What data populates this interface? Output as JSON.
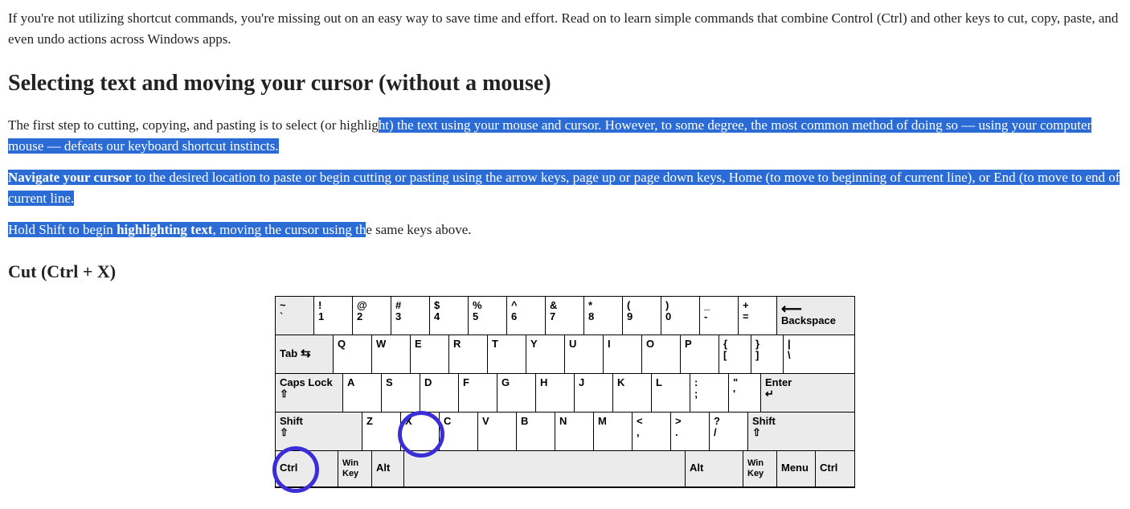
{
  "intro": "If you're not utilizing shortcut commands, you're missing out on an easy way to save time and effort. Read on to learn simple commands that combine Control (Ctrl) and other keys to cut, copy, paste, and even undo actions across Windows apps.",
  "h2": "Selecting text and moving your cursor (without a mouse)",
  "p2_plain1": "The first step to cutting, copying, and pasting is to select (or highlig",
  "p2_sel": "ht) the text using your mouse and cursor. However, to some degree, the most common method of doing so — using your computer mouse — defeats our keyboard shortcut instincts.",
  "p3_bold": "Navigate your cursor",
  "p3_rest": " to the desired location to paste or begin cutting or pasting using the arrow keys, page up or page down keys, Home (to move to beginning of current line), or End (to move to end of current line.",
  "p4_pre": "Hold Shift to begin ",
  "p4_bold": "highlighting text",
  "p4_mid": ", moving the cursor using th",
  "p4_end": "e same keys above.",
  "h3": "Cut (Ctrl + X)",
  "keys": {
    "tilde_top": "~",
    "tilde_bot": "`",
    "n1t": "!",
    "n1b": "1",
    "n2t": "@",
    "n2b": "2",
    "n3t": "#",
    "n3b": "3",
    "n4t": "$",
    "n4b": "4",
    "n5t": "%",
    "n5b": "5",
    "n6t": "^",
    "n6b": "6",
    "n7t": "&",
    "n7b": "7",
    "n8t": "*",
    "n8b": "8",
    "n9t": "(",
    "n9b": "9",
    "n0t": ")",
    "n0b": "0",
    "dasht": "_",
    "dashb": "-",
    "eqt": "+",
    "eqb": "=",
    "backspace": "Backspace",
    "tab": "Tab",
    "q": "Q",
    "w": "W",
    "e": "E",
    "r": "R",
    "t": "T",
    "y": "Y",
    "u": "U",
    "i": "I",
    "o": "O",
    "p": "P",
    "lbrkt_t": "{",
    "lbrkt_b": "[",
    "rbrkt_t": "}",
    "rbrkt_b": "]",
    "bslash_t": "|",
    "bslash_b": "\\",
    "caps": "Caps Lock",
    "a": "A",
    "s": "S",
    "d": "D",
    "f": "F",
    "g": "G",
    "h": "H",
    "j": "J",
    "k": "K",
    "l": "L",
    "semi_t": ":",
    "semi_b": ";",
    "quote_t": "\"",
    "quote_b": "'",
    "enter": "Enter",
    "shift": "Shift",
    "z": "Z",
    "x": "X",
    "c": "C",
    "v": "V",
    "b": "B",
    "n": "N",
    "m": "M",
    "comma_t": "<",
    "comma_b": ",",
    "period_t": ">",
    "period_b": ".",
    "slash_t": "?",
    "slash_b": "/",
    "ctrl": "Ctrl",
    "win": "Win Key",
    "alt": "Alt",
    "menu": "Menu"
  }
}
